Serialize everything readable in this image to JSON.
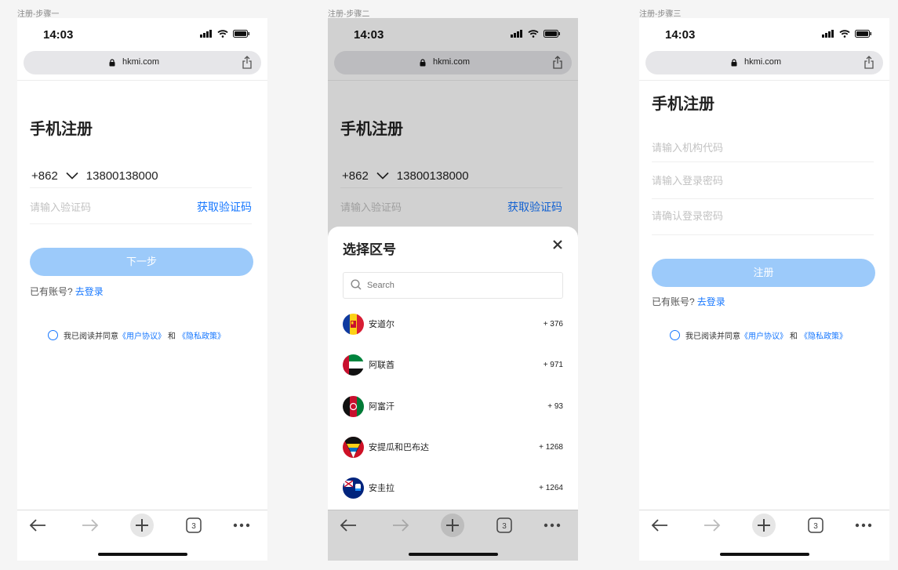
{
  "steps": [
    {
      "label": "注册-步骤一"
    },
    {
      "label": "注册-步骤二"
    },
    {
      "label": "注册-步骤三"
    }
  ],
  "status": {
    "time": "14:03"
  },
  "browser": {
    "url": "hkmi.com",
    "tab_count": "3"
  },
  "step1": {
    "title": "手机注册",
    "phone_code": "+862",
    "phone_number": "13800138000",
    "code_placeholder": "请输入验证码",
    "get_code": "获取验证码",
    "next_button": "下一步",
    "has_account": "已有账号?",
    "login_link": "去登录",
    "agree_text": "我已阅读并同意",
    "user_agreement": "《用户协议》",
    "and": "和",
    "privacy_policy": "《隐私政策》"
  },
  "step2": {
    "sheet_title": "选择区号",
    "search_placeholder": "Search",
    "countries": [
      {
        "name": "安道尔",
        "dial": "+ 376",
        "flag": "andorra"
      },
      {
        "name": "阿联酋",
        "dial": "+ 971",
        "flag": "uae"
      },
      {
        "name": "阿富汗",
        "dial": "+ 93",
        "flag": "afghanistan"
      },
      {
        "name": "安提瓜和巴布达",
        "dial": "+ 1268",
        "flag": "antigua-and-barbuda"
      },
      {
        "name": "安圭拉",
        "dial": "+ 1264",
        "flag": "anguilla"
      }
    ]
  },
  "step3": {
    "title": "手机注册",
    "org_code_placeholder": "请输入机构代码",
    "password_placeholder": "请输入登录密码",
    "confirm_password_placeholder": "请确认登录密码",
    "register_button": "注册",
    "has_account": "已有账号?",
    "login_link": "去登录",
    "agree_text": "我已阅读并同意",
    "user_agreement": "《用户协议》",
    "and": "和",
    "privacy_policy": "《隐私政策》"
  },
  "colors": {
    "accent": "#1677ff",
    "button_disabled": "#9ccafa",
    "overlay": "#d6d6d6"
  },
  "icons": [
    "signal-icon",
    "wifi-icon",
    "battery-icon",
    "lock-icon",
    "share-icon",
    "chevron-down-icon",
    "close-icon",
    "search-icon",
    "back-arrow-icon",
    "forward-arrow-icon",
    "new-tab-icon",
    "tabs-icon",
    "more-icon"
  ]
}
